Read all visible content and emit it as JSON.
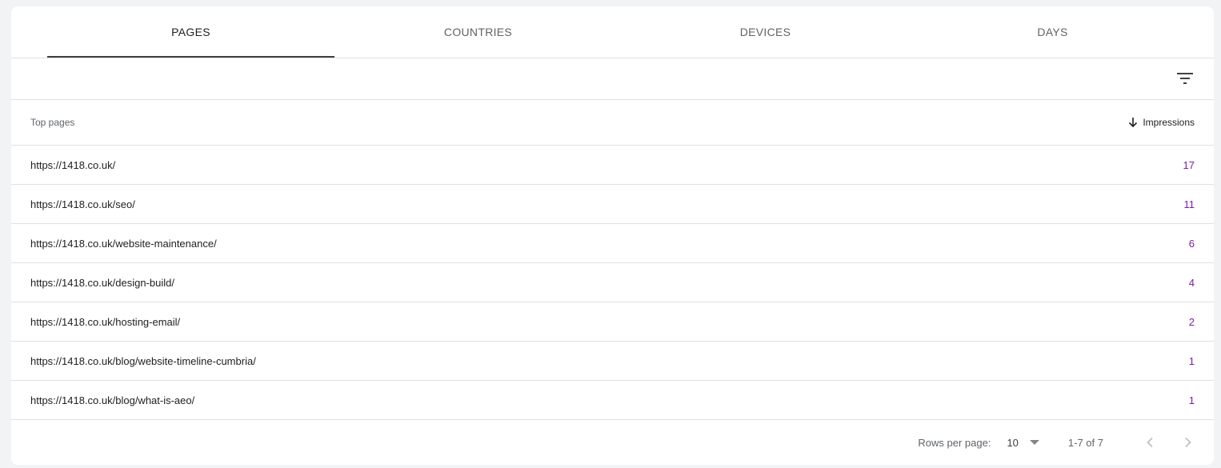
{
  "tabs": [
    {
      "label": "PAGES",
      "active": true
    },
    {
      "label": "COUNTRIES",
      "active": false
    },
    {
      "label": "DEVICES",
      "active": false
    },
    {
      "label": "DAYS",
      "active": false
    }
  ],
  "toolbar": {
    "filter_icon": "filter-icon"
  },
  "table": {
    "col_page": "Top pages",
    "col_metric": "Impressions",
    "sort_icon": "arrow-down-icon",
    "rows": [
      {
        "url": "https://1418.co.uk/",
        "impressions": "17"
      },
      {
        "url": "https://1418.co.uk/seo/",
        "impressions": "11"
      },
      {
        "url": "https://1418.co.uk/website-maintenance/",
        "impressions": "6"
      },
      {
        "url": "https://1418.co.uk/design-build/",
        "impressions": "4"
      },
      {
        "url": "https://1418.co.uk/hosting-email/",
        "impressions": "2"
      },
      {
        "url": "https://1418.co.uk/blog/website-timeline-cumbria/",
        "impressions": "1"
      },
      {
        "url": "https://1418.co.uk/blog/what-is-aeo/",
        "impressions": "1"
      }
    ]
  },
  "pager": {
    "rows_per_page_label": "Rows per page:",
    "rows_per_page_value": "10",
    "range": "1-7 of 7",
    "prev_icon": "chevron-left-icon",
    "next_icon": "chevron-right-icon"
  },
  "colors": {
    "metric": "#7b1fa2",
    "active_tab_indicator": "#3c4043"
  }
}
